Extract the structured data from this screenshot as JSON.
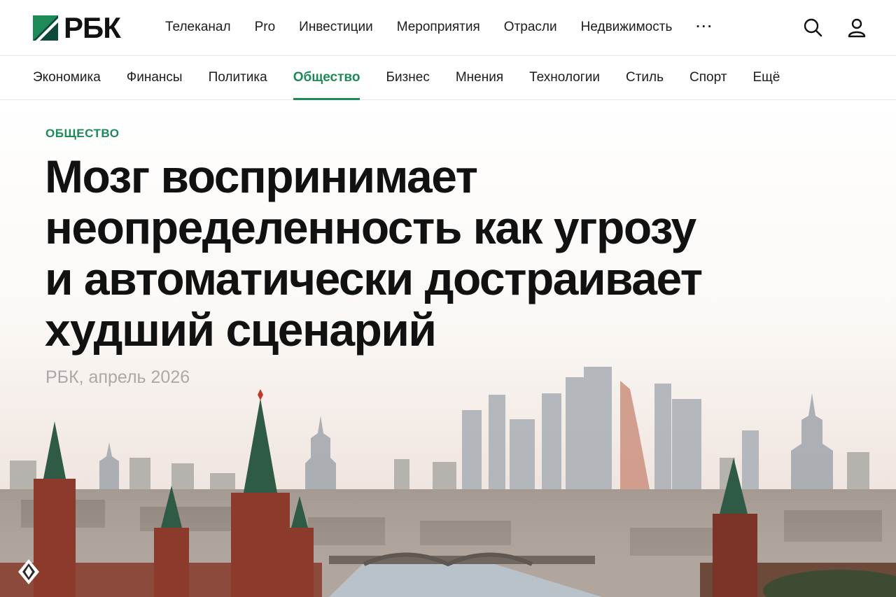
{
  "header": {
    "logo_text": "РБК",
    "nav": [
      "Телеканал",
      "Pro",
      "Инвестиции",
      "Мероприятия",
      "Отрасли",
      "Недвижимость"
    ],
    "more_label": "···",
    "icons": [
      "search-icon",
      "user-icon"
    ]
  },
  "subnav": {
    "items": [
      "Экономика",
      "Финансы",
      "Политика",
      "Общество",
      "Бизнес",
      "Мнения",
      "Технологии",
      "Стиль",
      "Спорт",
      "Ещё"
    ],
    "active": "Общество"
  },
  "article": {
    "rubric": "ОБЩЕСТВО",
    "headline": "Мозг воспринимает неопределенность как угрозу и автоматически достраивает худший сценарий",
    "byline": "РБК, апрель 2026"
  },
  "colors": {
    "accent": "#1d8a5a",
    "text": "#111111",
    "muted": "#a9a9a9"
  }
}
